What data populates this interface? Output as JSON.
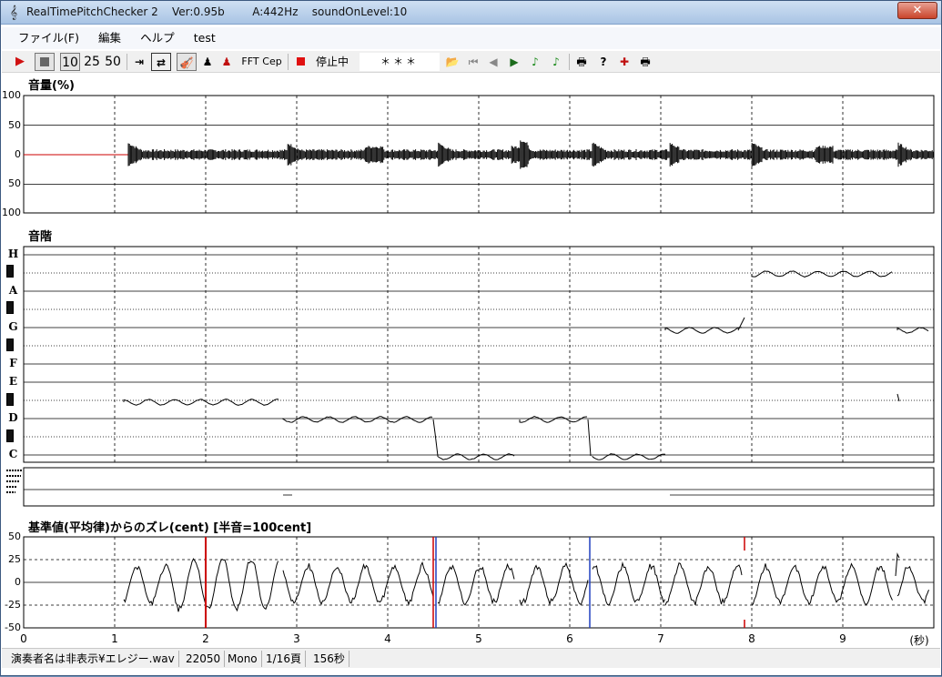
{
  "window": {
    "title": "RealTimePitchChecker 2    Ver:0.95b        A:442Hz    soundOnLevel:10",
    "close_label": "✕"
  },
  "menu": [
    "ファイル(F)",
    "編集",
    "ヘルプ",
    "test"
  ],
  "toolbar": {
    "zoom_10": "10",
    "zoom_25": "25",
    "zoom_50": "50",
    "fft": "FFT",
    "cep": "Cep",
    "status": "停止中",
    "placeholder": "＊＊＊"
  },
  "volume_panel": {
    "label": "音量(%)",
    "ticks": [
      "100",
      "50",
      "0",
      "50",
      "100"
    ]
  },
  "scale_panel": {
    "label": "音階",
    "notes": [
      "H",
      "A",
      "G",
      "F",
      "E",
      "D",
      "C"
    ]
  },
  "deviation_panel": {
    "label": "基準値(平均律)からのズレ(cent) [半音=100cent]",
    "ticks": [
      "50",
      "25",
      "0",
      "-25",
      "-50"
    ]
  },
  "time_axis": {
    "ticks": [
      "0",
      "1",
      "2",
      "3",
      "4",
      "5",
      "6",
      "7",
      "8",
      "9"
    ],
    "unit": "(秒)"
  },
  "statusbar": {
    "filename": "演奏者名は非表示¥エレジー.wav",
    "rate": "22050",
    "channels": "Mono",
    "page": "1/16頁",
    "duration": "156秒"
  },
  "chart_data": {
    "type": "line",
    "x_range": [
      0,
      10
    ],
    "pitch_segments": [
      {
        "start": 1.1,
        "end": 2.8,
        "note": "D#"
      },
      {
        "start": 2.85,
        "end": 4.5,
        "note": "D"
      },
      {
        "start": 4.55,
        "end": 5.4,
        "note": "C"
      },
      {
        "start": 5.45,
        "end": 6.2,
        "note": "D"
      },
      {
        "start": 6.25,
        "end": 7.05,
        "note": "C"
      },
      {
        "start": 7.05,
        "end": 7.9,
        "note": "G#"
      },
      {
        "start": 8.0,
        "end": 9.55,
        "note": "H-flat"
      },
      {
        "start": 9.6,
        "end": 9.95,
        "note": "G#"
      }
    ],
    "colors": {
      "signal": "#000000",
      "marker_red": "#cc0000",
      "marker_blue": "#1f3fbf",
      "grid": "#000000"
    }
  }
}
